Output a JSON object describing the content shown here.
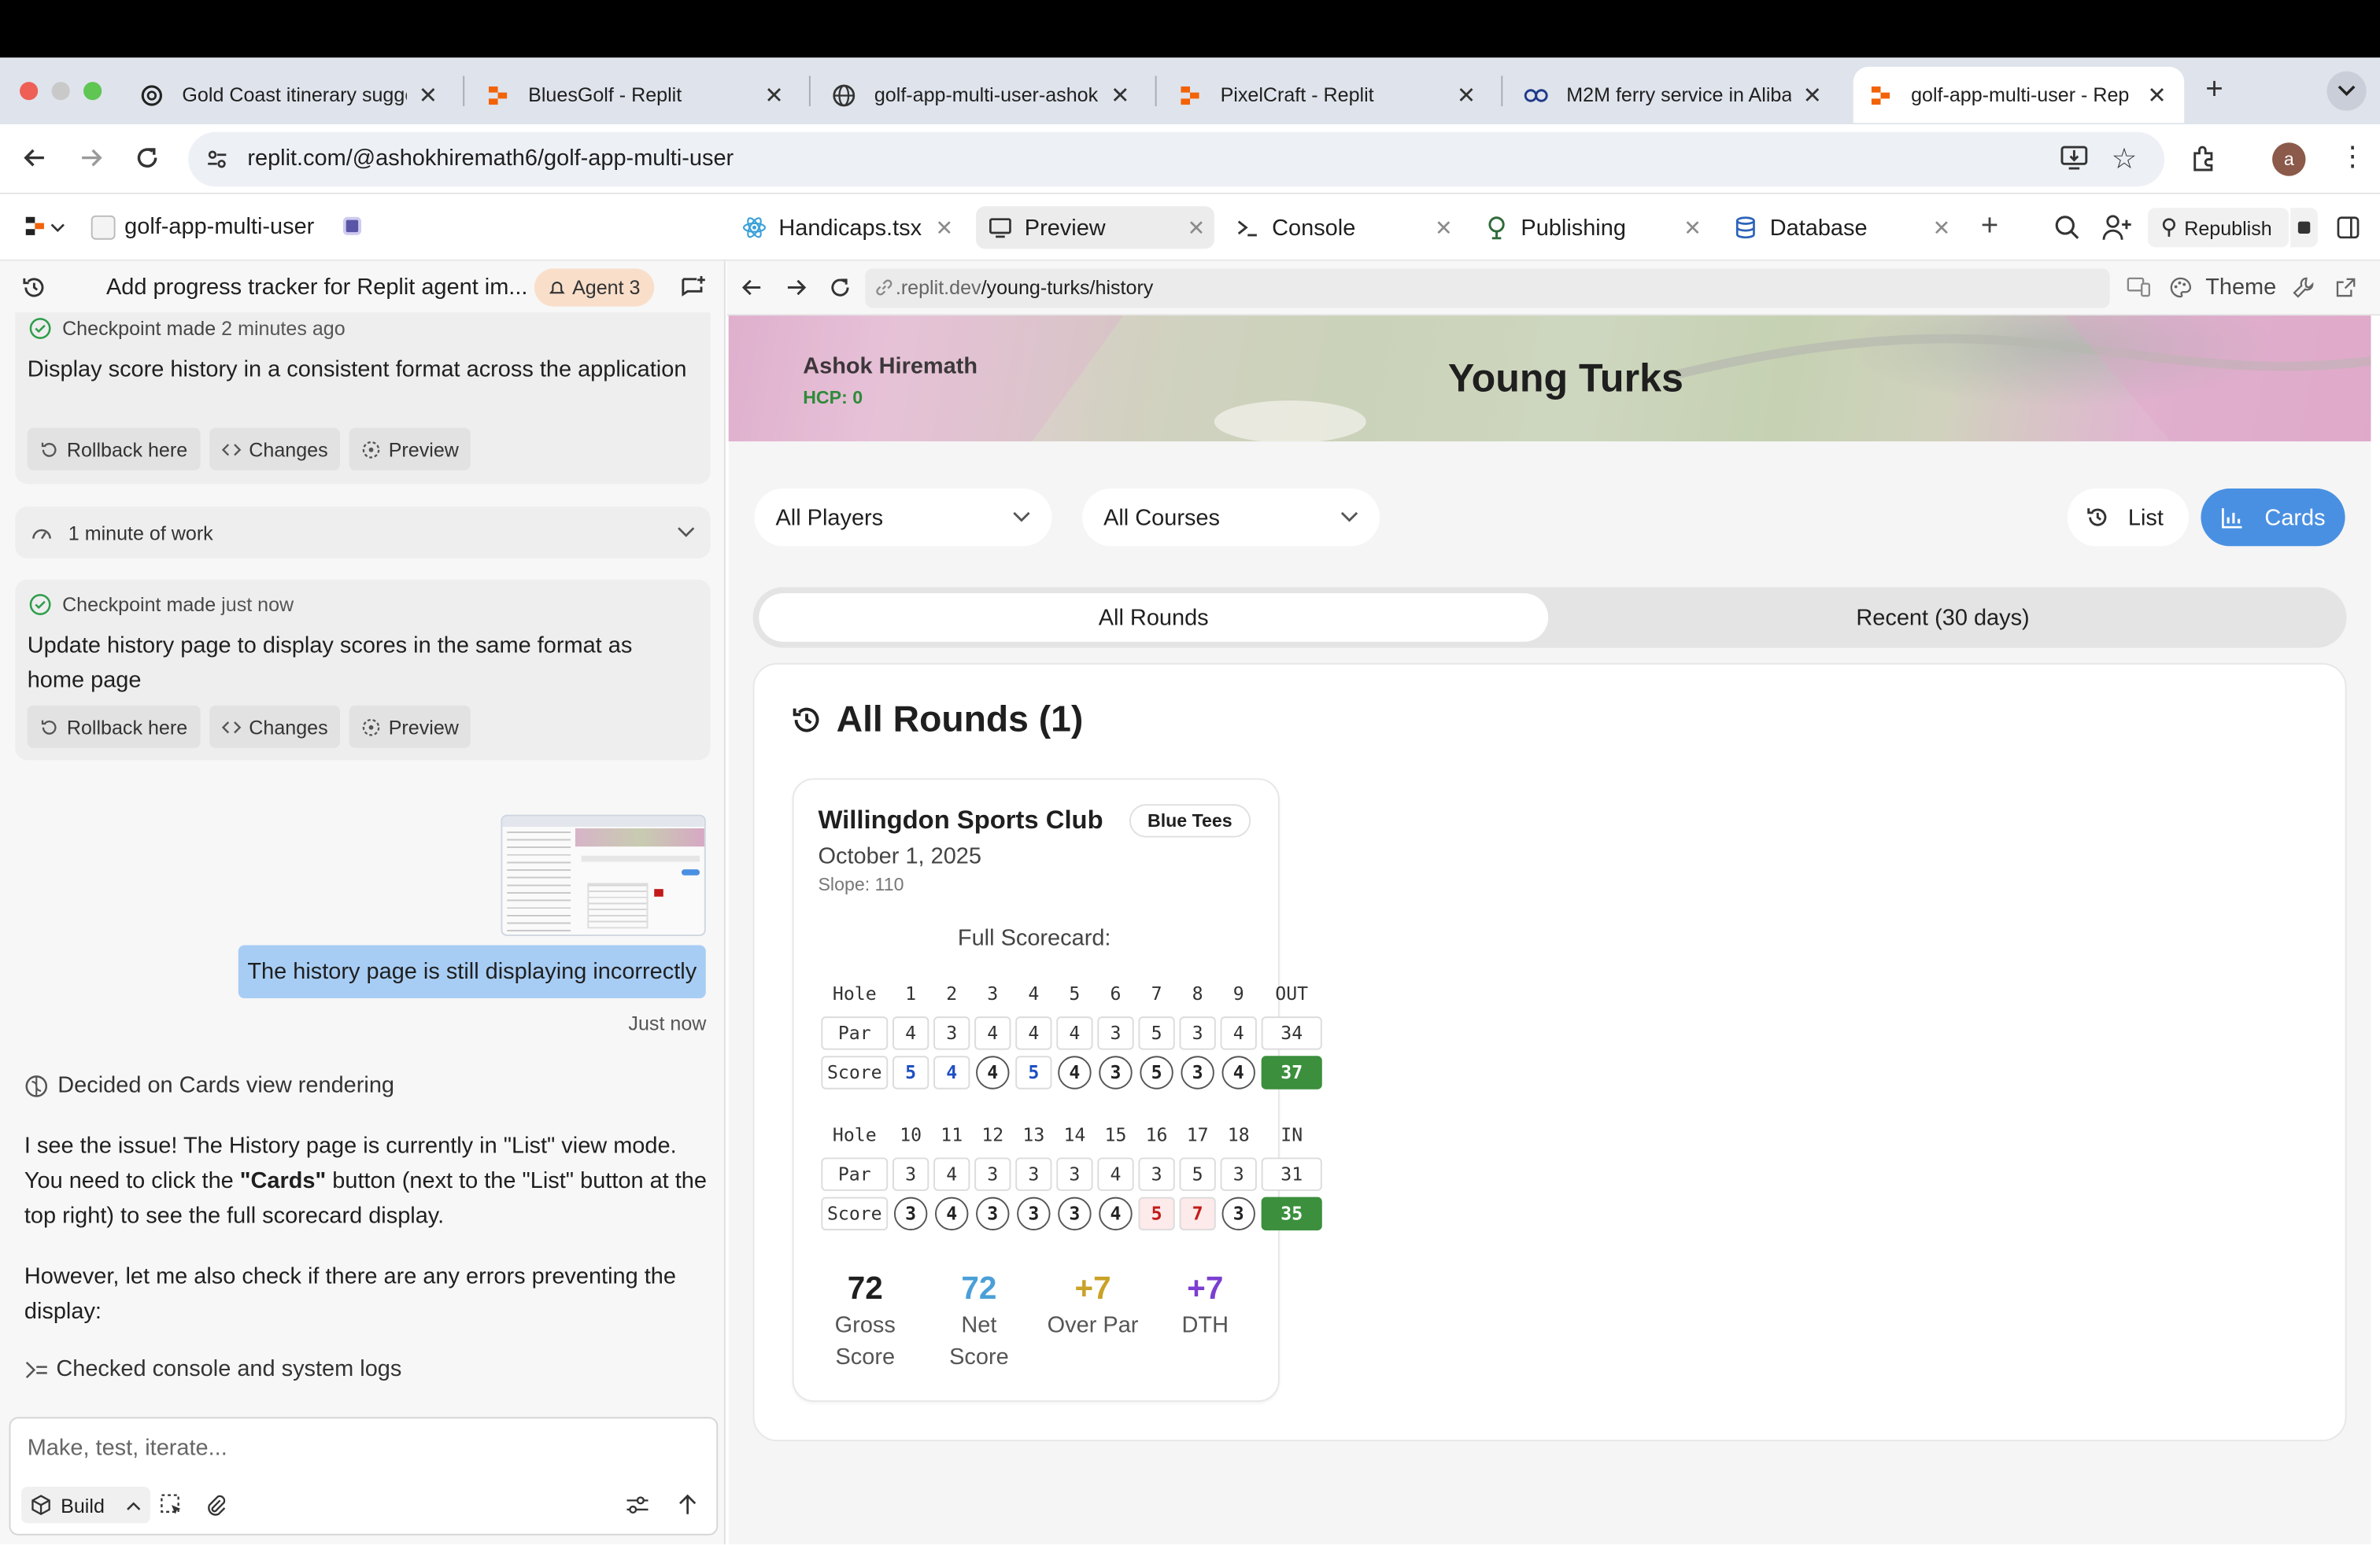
{
  "browser": {
    "tabs": [
      {
        "title": "Gold Coast itinerary sugge",
        "icon": "openai-icon"
      },
      {
        "title": "BluesGolf - Replit",
        "icon": "replit-icon"
      },
      {
        "title": "golf-app-multi-user-ashok",
        "icon": "globe-icon"
      },
      {
        "title": "PixelCraft - Replit",
        "icon": "replit-icon"
      },
      {
        "title": "M2M ferry service in Aliba",
        "icon": "ferry-icon"
      },
      {
        "title": "golf-app-multi-user - Rep",
        "icon": "replit-icon",
        "active": true
      }
    ],
    "url": "replit.com/@ashokhiremath6/golf-app-multi-user",
    "profile_initial": "a"
  },
  "workspace": {
    "project_name": "golf-app-multi-user",
    "tabs": [
      {
        "label": "Handicaps.tsx",
        "icon": "react-icon"
      },
      {
        "label": "Preview",
        "icon": "preview-icon",
        "active": true
      },
      {
        "label": "Console",
        "icon": "terminal-icon"
      },
      {
        "label": "Publishing",
        "icon": "publishing-icon"
      },
      {
        "label": "Database",
        "icon": "database-icon"
      }
    ],
    "republish_label": "Republish"
  },
  "chat": {
    "thread_title": "Add progress tracker for Replit agent im...",
    "agent_badge": "Agent 3",
    "checkpoint1": {
      "status": "Checkpoint made",
      "time": "2 minutes ago",
      "text": "Display score history in a consistent format across the application"
    },
    "work_summary": "1 minute of work",
    "checkpoint2": {
      "status": "Checkpoint made",
      "time": "just now",
      "text": "Update history page to display scores in the same format as home page"
    },
    "actions": {
      "rollback": "Rollback here",
      "changes": "Changes",
      "preview": "Preview"
    },
    "user_message": "The history page is still displaying incorrectly",
    "user_time": "Just now",
    "decided": "Decided on Cards view rendering",
    "response_p1_a": "I see the issue! The History page is currently in \"List\" view mode. You need to click the ",
    "response_p1_bold": "\"Cards\"",
    "response_p1_b": " button (next to the \"List\" button at the top right) to see the full scorecard display.",
    "response_p2": "However, let me also check if there are any errors preventing the display:",
    "checked": "Checked console and system logs",
    "input_placeholder": "Make, test, iterate...",
    "build_label": "Build"
  },
  "preview": {
    "url_prefix": ".replit.dev",
    "url_path": "/young-turks/history",
    "theme_label": "Theme",
    "player_name": "Ashok Hiremath",
    "hcp": "HCP: 0",
    "group_title": "Young Turks",
    "filters": {
      "players": "All Players",
      "courses": "All Courses"
    },
    "view_list": "List",
    "view_cards": "Cards",
    "segment": {
      "all": "All Rounds",
      "recent": "Recent (30 days)"
    },
    "section_title": "All Rounds (1)",
    "round": {
      "club": "Willingdon Sports Club",
      "tees": "Blue Tees",
      "date": "October 1, 2025",
      "slope": "Slope: 110",
      "scorecard_title": "Full Scorecard:",
      "front": {
        "hole_label": "Hole",
        "par_label": "Par",
        "score_label": "Score",
        "holes": [
          "1",
          "2",
          "3",
          "4",
          "5",
          "6",
          "7",
          "8",
          "9"
        ],
        "total_label": "OUT",
        "par": [
          "4",
          "3",
          "4",
          "4",
          "4",
          "3",
          "5",
          "3",
          "4"
        ],
        "par_total": "34",
        "score": [
          "5",
          "4",
          "4",
          "5",
          "4",
          "3",
          "5",
          "3",
          "4"
        ],
        "score_total": "37"
      },
      "back": {
        "hole_label": "Hole",
        "par_label": "Par",
        "score_label": "Score",
        "holes": [
          "10",
          "11",
          "12",
          "13",
          "14",
          "15",
          "16",
          "17",
          "18"
        ],
        "total_label": "IN",
        "par": [
          "3",
          "4",
          "3",
          "3",
          "3",
          "4",
          "3",
          "5",
          "3"
        ],
        "par_total": "31",
        "score": [
          "3",
          "4",
          "3",
          "3",
          "3",
          "4",
          "5",
          "7",
          "3"
        ],
        "score_total": "35"
      },
      "stats": [
        {
          "value": "72",
          "label": "Gross Score",
          "color": "#1f1f1f"
        },
        {
          "value": "72",
          "label": "Net Score",
          "color": "#4a9fd8"
        },
        {
          "value": "+7",
          "label": "Over Par",
          "color": "#c9a227"
        },
        {
          "value": "+7",
          "label": "DTH",
          "color": "#7b3fd0"
        }
      ]
    }
  },
  "colors": {
    "accent_blue": "#4a90e2",
    "green_total": "#3b8f3d",
    "hcp_green": "#2e8b3a",
    "user_bubble": "#a8cdf4"
  }
}
